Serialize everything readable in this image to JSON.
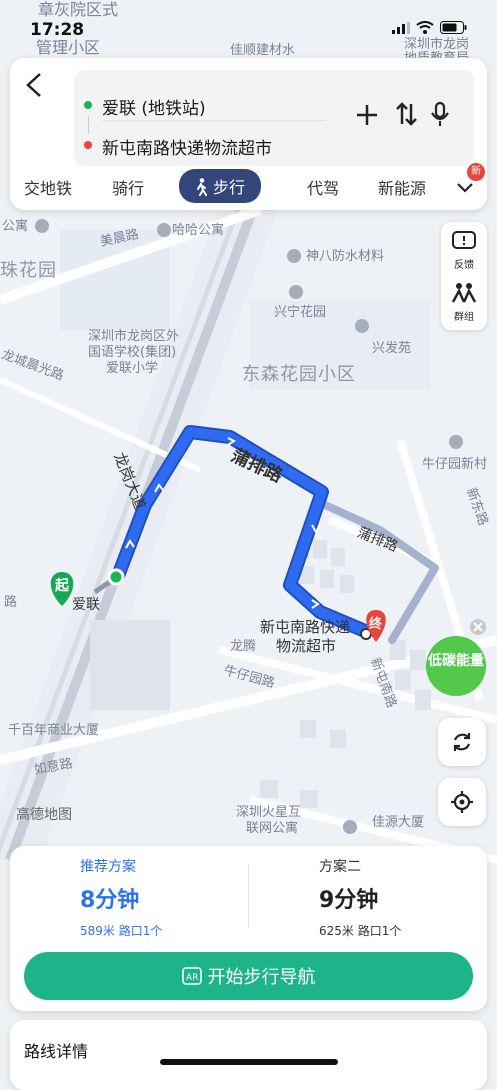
{
  "status_bar": {
    "time": "17:28"
  },
  "search": {
    "origin": "爱联 (地铁站)",
    "destination": "新屯南路快递物流超市"
  },
  "mode_tabs": [
    {
      "label": "交地铁"
    },
    {
      "label": "骑行"
    },
    {
      "label": "步行"
    },
    {
      "label": "代驾"
    },
    {
      "label": "新能源"
    }
  ],
  "tabs_more_badge": "新",
  "side_tools": {
    "feedback": "反馈",
    "group": "群组"
  },
  "low_carbon": "低碳能量",
  "map_labels": {
    "top_a": "章灰院区式",
    "top_b": "管理小区",
    "jiahui": "佳顺建材水",
    "gongan": "深圳市龙岗",
    "gongan2": "地质教育局",
    "gongyu": "公寓",
    "meichen": "美晨路",
    "hada": "哈哈公寓",
    "shenba": "神八防水材料",
    "zhuhuayuan": "珠花园",
    "xingning": "兴宁花园",
    "school1": "深圳市龙岗区外",
    "school2": "国语学校(集团)",
    "school3": "爱联小学",
    "xingfa": "兴发苑",
    "dongsen": "东森花园小区",
    "chenguang": "龙城晨光路",
    "longgang": "龙岗大道",
    "puxpai": "蒲排路",
    "niuzai_xc": "牛仔园新村",
    "xindong": "新东路",
    "puxpai2": "蒲排路",
    "qi": "起",
    "ailian": "爱联",
    "zhong": "终",
    "dest_1": "新屯南路快递",
    "dest_2": "物流超市",
    "longteng": "龙腾",
    "xintun": "新屯南路",
    "niuzai_road": "牛仔园路",
    "qianbai": "千百年商业大厦",
    "ruyi": "如意路",
    "gaode": "高德地图",
    "huoxing1": "深圳火星互",
    "huoxing2": "联网公寓",
    "jia": "佳源大厦",
    "lu": "路"
  },
  "plans": [
    {
      "tag": "推荐方案",
      "time": "8分钟",
      "detail": "589米  路口1个"
    },
    {
      "tag": "方案二",
      "time": "9分钟",
      "detail": "625米  路口1个"
    }
  ],
  "start_nav": "开始步行导航",
  "route_details": "路线详情",
  "colors": {
    "route": "#2f6bf0",
    "active_tab": "#33467a",
    "nav_button": "#1db48a",
    "recommended": "#2b73e8"
  }
}
